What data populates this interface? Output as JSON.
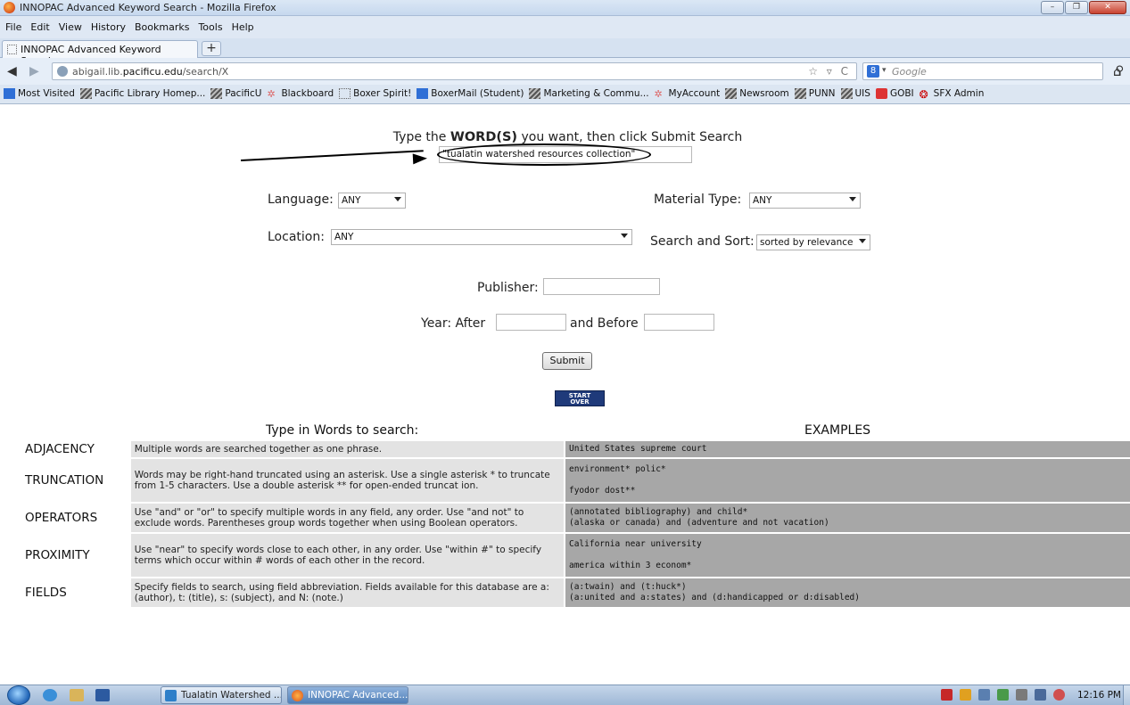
{
  "window": {
    "title": "INNOPAC Advanced Keyword Search - Mozilla Firefox"
  },
  "menu": [
    "File",
    "Edit",
    "View",
    "History",
    "Bookmarks",
    "Tools",
    "Help"
  ],
  "tab": {
    "label": "INNOPAC Advanced Keyword Search",
    "new_tab": "+"
  },
  "nav": {
    "url_prefix": "abigail.lib.",
    "url_domain": "pacificu.edu",
    "url_path": "/search/X",
    "url_tools": "☆ ▿ C",
    "search_placeholder": "Google"
  },
  "bookmarks": [
    {
      "label": "Most Visited",
      "icon": "most-visited-icon"
    },
    {
      "label": "Pacific Library Homep...",
      "icon": "stripes-icon"
    },
    {
      "label": "PacificU",
      "icon": "stripes-icon"
    },
    {
      "label": "Blackboard",
      "icon": "star-icon"
    },
    {
      "label": "Boxer Spirit!",
      "icon": "page-icon"
    },
    {
      "label": "BoxerMail (Student)",
      "icon": "blue-icon"
    },
    {
      "label": "Marketing & Commu...",
      "icon": "stripes-icon"
    },
    {
      "label": "MyAccount",
      "icon": "star-icon"
    },
    {
      "label": "Newsroom",
      "icon": "stripes-icon"
    },
    {
      "label": "PUNN",
      "icon": "stripes-icon"
    },
    {
      "label": "UIS",
      "icon": "stripes-icon"
    },
    {
      "label": "GOBI",
      "icon": "gobi-icon"
    },
    {
      "label": "SFX Admin",
      "icon": "sfx-icon"
    }
  ],
  "search": {
    "prompt_before": "Type the ",
    "prompt_words": "WORD(S)",
    "prompt_after": " you want, then click Submit Search",
    "keyword_value": "\"tualatin watershed resources collection\"",
    "language_label": "Language:",
    "language_value": "ANY",
    "material_label": "Material Type:",
    "material_value": "ANY",
    "location_label": "Location:",
    "location_value": "ANY",
    "sort_label": "Search and Sort:",
    "sort_value": "sorted by relevance",
    "publisher_label": "Publisher:",
    "year_after_label": "Year: After",
    "year_before_label": "and Before",
    "submit_label": "Submit",
    "start_over_line1": "START",
    "start_over_line2": "OVER"
  },
  "help": {
    "left_heading": "Type in Words to search:",
    "right_heading": "EXAMPLES",
    "rows": [
      {
        "term": "ADJACENCY",
        "desc": "Multiple words are searched together as one phrase.",
        "ex1": "United States supreme court",
        "ex2": ""
      },
      {
        "term": "TRUNCATION",
        "desc": "Words may be right-hand truncated using an asterisk. Use a single asterisk * to truncate from 1-5 characters. Use a double asterisk ** for open-ended truncat ion.",
        "ex1": "environment* polic*",
        "ex2": "fyodor dost**"
      },
      {
        "term": "OPERATORS",
        "desc": "Use \"and\" or \"or\" to specify multiple words in any field, any order. Use \"and not\" to exclude words. Parentheses group words together when using Boolean operators.",
        "ex1": "(annotated bibliography) and child*",
        "ex2": "(alaska or canada) and (adventure and not vacation)"
      },
      {
        "term": "PROXIMITY",
        "desc": "Use \"near\" to specify words close to each other, in any order. Use \"within #\" to specify terms which occur within # words of each other in the record.",
        "ex1": "California near university",
        "ex2": "america within 3 econom*"
      },
      {
        "term": "FIELDS",
        "desc": "Specify fields to search, using field abbreviation. Fields available for this database are a: (author), t: (title), s: (subject), and N: (note.)",
        "ex1": "(a:twain) and (t:huck*)",
        "ex2": "(a:united and a:states) and (d:handicapped or d:disabled)"
      }
    ]
  },
  "taskbar": {
    "task1": "Tualatin Watershed ...",
    "task2": "INNOPAC Advanced...",
    "clock": "12:16 PM"
  }
}
